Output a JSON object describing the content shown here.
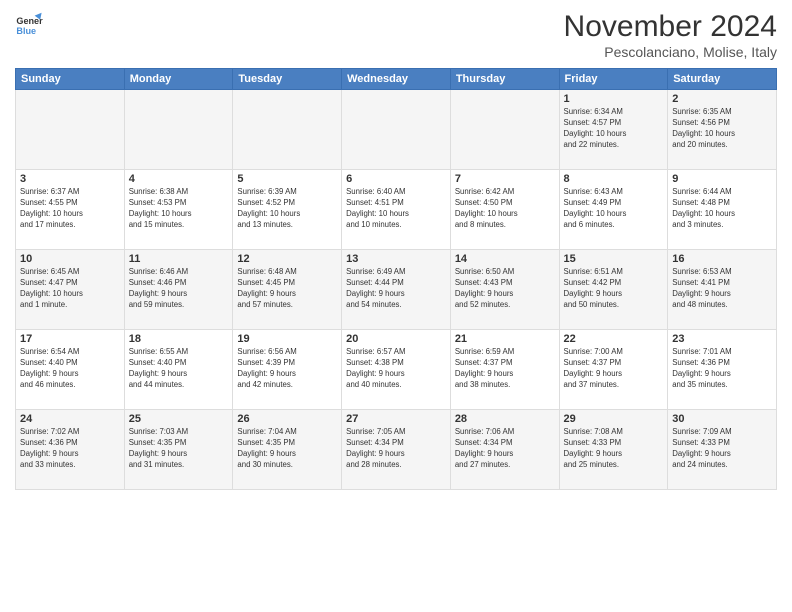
{
  "logo": {
    "line1": "General",
    "line2": "Blue"
  },
  "title": "November 2024",
  "subtitle": "Pescolanciano, Molise, Italy",
  "days_of_week": [
    "Sunday",
    "Monday",
    "Tuesday",
    "Wednesday",
    "Thursday",
    "Friday",
    "Saturday"
  ],
  "weeks": [
    [
      {
        "day": "",
        "info": ""
      },
      {
        "day": "",
        "info": ""
      },
      {
        "day": "",
        "info": ""
      },
      {
        "day": "",
        "info": ""
      },
      {
        "day": "",
        "info": ""
      },
      {
        "day": "1",
        "info": "Sunrise: 6:34 AM\nSunset: 4:57 PM\nDaylight: 10 hours\nand 22 minutes."
      },
      {
        "day": "2",
        "info": "Sunrise: 6:35 AM\nSunset: 4:56 PM\nDaylight: 10 hours\nand 20 minutes."
      }
    ],
    [
      {
        "day": "3",
        "info": "Sunrise: 6:37 AM\nSunset: 4:55 PM\nDaylight: 10 hours\nand 17 minutes."
      },
      {
        "day": "4",
        "info": "Sunrise: 6:38 AM\nSunset: 4:53 PM\nDaylight: 10 hours\nand 15 minutes."
      },
      {
        "day": "5",
        "info": "Sunrise: 6:39 AM\nSunset: 4:52 PM\nDaylight: 10 hours\nand 13 minutes."
      },
      {
        "day": "6",
        "info": "Sunrise: 6:40 AM\nSunset: 4:51 PM\nDaylight: 10 hours\nand 10 minutes."
      },
      {
        "day": "7",
        "info": "Sunrise: 6:42 AM\nSunset: 4:50 PM\nDaylight: 10 hours\nand 8 minutes."
      },
      {
        "day": "8",
        "info": "Sunrise: 6:43 AM\nSunset: 4:49 PM\nDaylight: 10 hours\nand 6 minutes."
      },
      {
        "day": "9",
        "info": "Sunrise: 6:44 AM\nSunset: 4:48 PM\nDaylight: 10 hours\nand 3 minutes."
      }
    ],
    [
      {
        "day": "10",
        "info": "Sunrise: 6:45 AM\nSunset: 4:47 PM\nDaylight: 10 hours\nand 1 minute."
      },
      {
        "day": "11",
        "info": "Sunrise: 6:46 AM\nSunset: 4:46 PM\nDaylight: 9 hours\nand 59 minutes."
      },
      {
        "day": "12",
        "info": "Sunrise: 6:48 AM\nSunset: 4:45 PM\nDaylight: 9 hours\nand 57 minutes."
      },
      {
        "day": "13",
        "info": "Sunrise: 6:49 AM\nSunset: 4:44 PM\nDaylight: 9 hours\nand 54 minutes."
      },
      {
        "day": "14",
        "info": "Sunrise: 6:50 AM\nSunset: 4:43 PM\nDaylight: 9 hours\nand 52 minutes."
      },
      {
        "day": "15",
        "info": "Sunrise: 6:51 AM\nSunset: 4:42 PM\nDaylight: 9 hours\nand 50 minutes."
      },
      {
        "day": "16",
        "info": "Sunrise: 6:53 AM\nSunset: 4:41 PM\nDaylight: 9 hours\nand 48 minutes."
      }
    ],
    [
      {
        "day": "17",
        "info": "Sunrise: 6:54 AM\nSunset: 4:40 PM\nDaylight: 9 hours\nand 46 minutes."
      },
      {
        "day": "18",
        "info": "Sunrise: 6:55 AM\nSunset: 4:40 PM\nDaylight: 9 hours\nand 44 minutes."
      },
      {
        "day": "19",
        "info": "Sunrise: 6:56 AM\nSunset: 4:39 PM\nDaylight: 9 hours\nand 42 minutes."
      },
      {
        "day": "20",
        "info": "Sunrise: 6:57 AM\nSunset: 4:38 PM\nDaylight: 9 hours\nand 40 minutes."
      },
      {
        "day": "21",
        "info": "Sunrise: 6:59 AM\nSunset: 4:37 PM\nDaylight: 9 hours\nand 38 minutes."
      },
      {
        "day": "22",
        "info": "Sunrise: 7:00 AM\nSunset: 4:37 PM\nDaylight: 9 hours\nand 37 minutes."
      },
      {
        "day": "23",
        "info": "Sunrise: 7:01 AM\nSunset: 4:36 PM\nDaylight: 9 hours\nand 35 minutes."
      }
    ],
    [
      {
        "day": "24",
        "info": "Sunrise: 7:02 AM\nSunset: 4:36 PM\nDaylight: 9 hours\nand 33 minutes."
      },
      {
        "day": "25",
        "info": "Sunrise: 7:03 AM\nSunset: 4:35 PM\nDaylight: 9 hours\nand 31 minutes."
      },
      {
        "day": "26",
        "info": "Sunrise: 7:04 AM\nSunset: 4:35 PM\nDaylight: 9 hours\nand 30 minutes."
      },
      {
        "day": "27",
        "info": "Sunrise: 7:05 AM\nSunset: 4:34 PM\nDaylight: 9 hours\nand 28 minutes."
      },
      {
        "day": "28",
        "info": "Sunrise: 7:06 AM\nSunset: 4:34 PM\nDaylight: 9 hours\nand 27 minutes."
      },
      {
        "day": "29",
        "info": "Sunrise: 7:08 AM\nSunset: 4:33 PM\nDaylight: 9 hours\nand 25 minutes."
      },
      {
        "day": "30",
        "info": "Sunrise: 7:09 AM\nSunset: 4:33 PM\nDaylight: 9 hours\nand 24 minutes."
      }
    ]
  ]
}
